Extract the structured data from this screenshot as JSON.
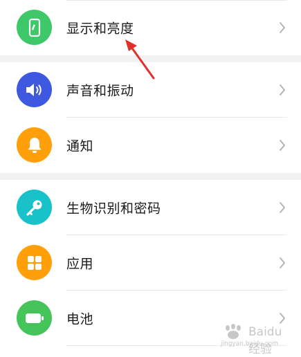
{
  "colors": {
    "display": "#3fc86a",
    "sound": "#3f58e0",
    "notify": "#ff9f0a",
    "biometric": "#19c2c8",
    "apps": "#ff9f0a",
    "battery": "#44c45a",
    "arrow": "#e0302a"
  },
  "settings": {
    "groups": [
      {
        "items": [
          {
            "label": "显示和亮度",
            "icon": "phone-brightness-icon"
          }
        ]
      },
      {
        "items": [
          {
            "label": "声音和振动",
            "icon": "speaker-icon"
          },
          {
            "label": "通知",
            "icon": "bell-icon"
          }
        ]
      },
      {
        "items": [
          {
            "label": "生物识别和密码",
            "icon": "key-icon"
          },
          {
            "label": "应用",
            "icon": "apps-grid-icon"
          },
          {
            "label": "电池",
            "icon": "battery-icon"
          }
        ]
      }
    ]
  },
  "watermark": {
    "brand": "Baidu 经验",
    "url": "jingyan.baidu.com"
  }
}
